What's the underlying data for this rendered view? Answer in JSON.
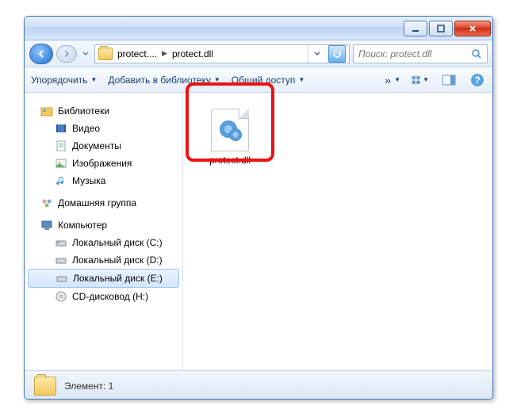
{
  "breadcrumb": {
    "folder": "protect....",
    "current": "protect.dll"
  },
  "search": {
    "placeholder": "Поиск: protect.dll"
  },
  "toolbar": {
    "organize": "Упорядочить",
    "library": "Добавить в библиотеку",
    "share": "Общий доступ"
  },
  "sidebar": {
    "libraries": "Библиотеки",
    "video": "Видео",
    "documents": "Документы",
    "pictures": "Изображения",
    "music": "Музыка",
    "homegroup": "Домашняя группа",
    "computer": "Компьютер",
    "diskC": "Локальный диск (C:)",
    "diskD": "Локальный диск (D:)",
    "diskE": "Локальный диск (E:)",
    "cdH": "CD-дисковод (H:)"
  },
  "file": {
    "name": "protect.dll"
  },
  "status": {
    "text": "Элемент: 1"
  }
}
